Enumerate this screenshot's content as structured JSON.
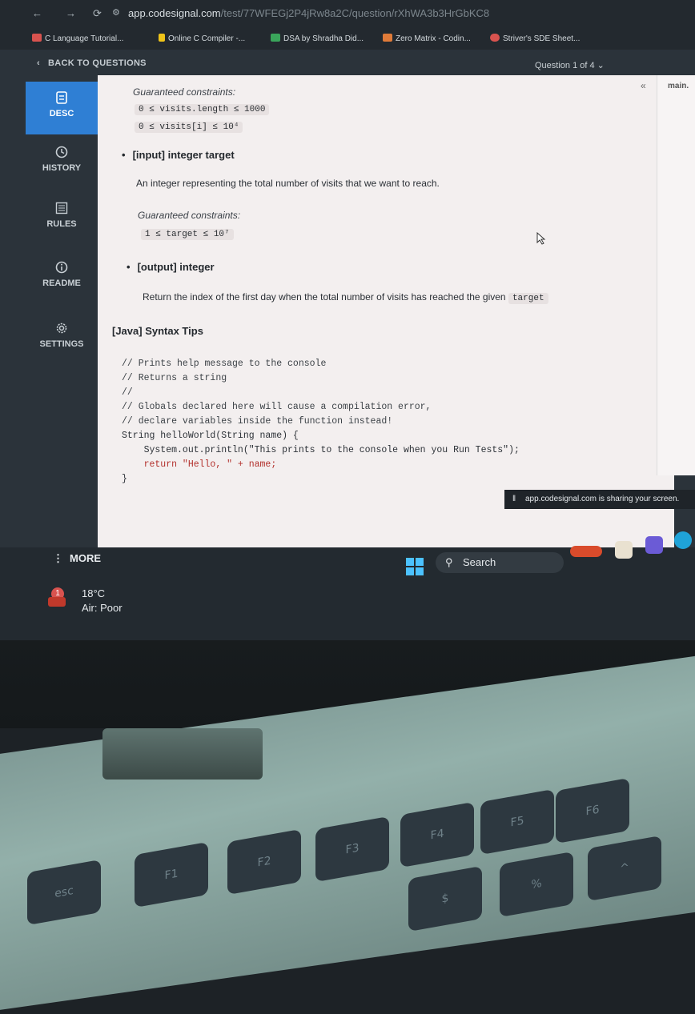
{
  "browser": {
    "url_host": "app.codesignal.com",
    "url_path": "/test/77WFEGj2P4jRw8a2C/question/rXhWA3b3HrGbKC8",
    "bookmarks": [
      {
        "label": "C Language Tutorial...",
        "color": "#d9534f"
      },
      {
        "label": "Online C Compiler -...",
        "color": "#f0c419"
      },
      {
        "label": "DSA by Shradha Did...",
        "color": "#3aa55b"
      },
      {
        "label": "Zero Matrix - Codin...",
        "color": "#e07b39"
      },
      {
        "label": "Striver's SDE Sheet...",
        "color": "#d9534f"
      }
    ]
  },
  "appbar": {
    "back_label": "BACK TO QUESTIONS",
    "question_counter": "Question 1 of 4"
  },
  "rail": {
    "items": [
      {
        "label": "DESC",
        "icon": "document-icon"
      },
      {
        "label": "HISTORY",
        "icon": "clock-icon"
      },
      {
        "label": "RULES",
        "icon": "list-icon"
      },
      {
        "label": "README",
        "icon": "info-icon"
      },
      {
        "label": "SETTINGS",
        "icon": "gear-icon"
      }
    ],
    "more_label": "MORE"
  },
  "content": {
    "constraints_label_1": "Guaranteed constraints:",
    "constraint_1a": "0 ≤ visits.length ≤ 1000",
    "constraint_1b": "0 ≤ visits[i] ≤ 10⁴",
    "input_target": "[input] integer target",
    "input_target_desc": "An integer representing the total number of visits that we want to reach.",
    "constraints_label_2": "Guaranteed constraints:",
    "constraint_2a": "1 ≤ target ≤ 10⁷",
    "output_label": "[output] integer",
    "output_desc": "Return the index of the first day when the total number of visits has reached the given",
    "output_chip": "target",
    "syntax_tips_title": "[Java] Syntax Tips",
    "code_lines": [
      "// Prints help message to the console",
      "// Returns a string",
      "//",
      "// Globals declared here will cause a compilation error,",
      "// declare variables inside the function instead!",
      "String helloWorld(String name) {",
      "    System.out.println(\"This prints to the console when you Run Tests\");",
      "    return \"Hello, \" + name;",
      "}"
    ]
  },
  "side": {
    "collapse": "«",
    "main_tab": "main."
  },
  "share_banner": "app.codesignal.com is sharing your screen.",
  "taskbar": {
    "weather_temp": "18°C",
    "weather_air": "Air: Poor",
    "weather_badge": "1",
    "search_label": "Search"
  },
  "keyboard": {
    "keys": [
      "esc",
      "F1",
      "F2",
      "F3",
      "F4",
      "F5",
      "F6",
      "$",
      "%",
      "^"
    ]
  }
}
